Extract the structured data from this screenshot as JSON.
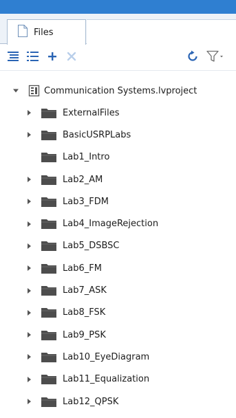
{
  "panel": {
    "tab_label": "Files"
  },
  "toolbar": {
    "items": [
      {
        "icon": "expand-all-icon"
      },
      {
        "icon": "collapse-all-icon"
      },
      {
        "icon": "plus-icon"
      },
      {
        "icon": "close-icon"
      },
      {
        "icon": "refresh-icon"
      },
      {
        "icon": "filter-icon"
      }
    ]
  },
  "tree": {
    "root": {
      "label": "Communication Systems.lvproject",
      "expanded": true
    },
    "items": [
      {
        "label": "ExternalFiles",
        "has_children": true
      },
      {
        "label": "BasicUSRPLabs",
        "has_children": true
      },
      {
        "label": "Lab1_Intro",
        "has_children": false
      },
      {
        "label": "Lab2_AM",
        "has_children": true
      },
      {
        "label": "Lab3_FDM",
        "has_children": true
      },
      {
        "label": "Lab4_ImageRejection",
        "has_children": true
      },
      {
        "label": "Lab5_DSBSC",
        "has_children": true
      },
      {
        "label": "Lab6_FM",
        "has_children": true
      },
      {
        "label": "Lab7_ASK",
        "has_children": true
      },
      {
        "label": "Lab8_FSK",
        "has_children": true
      },
      {
        "label": "Lab9_PSK",
        "has_children": true
      },
      {
        "label": "Lab10_EyeDiagram",
        "has_children": true
      },
      {
        "label": "Lab11_Equalization",
        "has_children": true
      },
      {
        "label": "Lab12_QPSK",
        "has_children": true
      }
    ]
  },
  "colors": {
    "accent": "#2f7fd1",
    "folder": "#4d4d4d",
    "icon_blue": "#2a64b4",
    "disabled": "#b9cfea"
  }
}
